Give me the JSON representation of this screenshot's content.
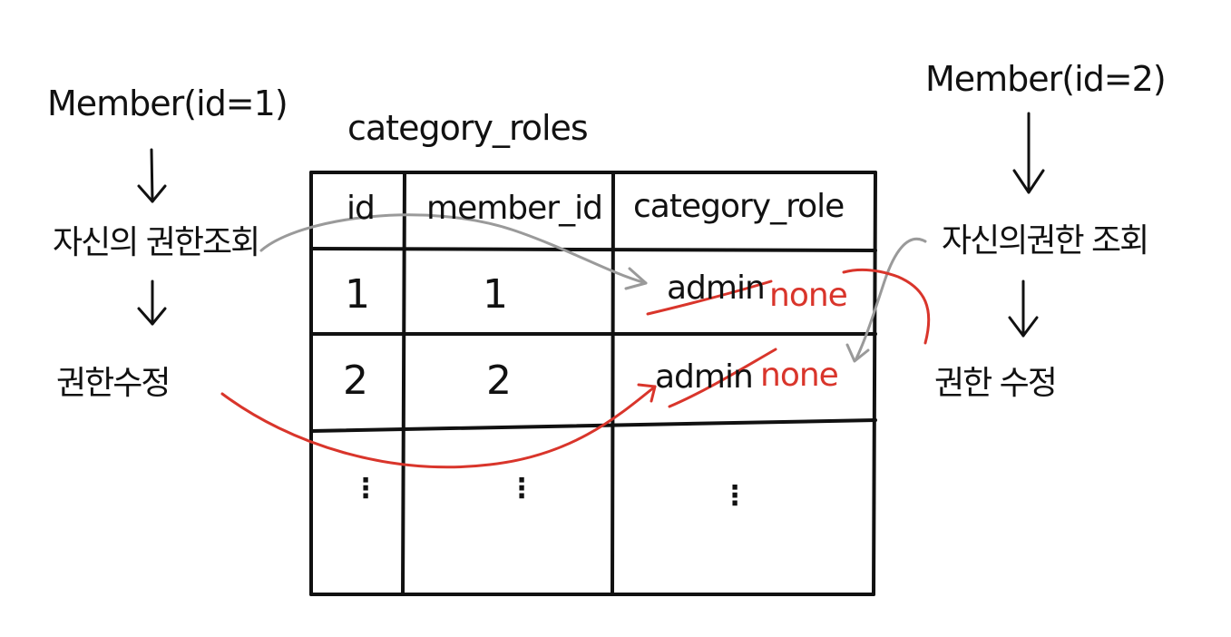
{
  "left_flow": {
    "member": "Member(id=1)",
    "step1": "자신의 권한조회",
    "step2": "권한수정"
  },
  "right_flow": {
    "member": "Member(id=2)",
    "step1": "자신의권한 조회",
    "step2": "권한 수정"
  },
  "table": {
    "name": "category_roles",
    "headers": [
      "id",
      "member_id",
      "category_role"
    ],
    "rows": [
      {
        "id": "1",
        "member_id": "1",
        "old_role": "admin",
        "new_role": "none"
      },
      {
        "id": "2",
        "member_id": "2",
        "old_role": "admin",
        "new_role": "none"
      }
    ],
    "ellipsis": "⋮"
  },
  "colors": {
    "ink": "#111111",
    "read_arrow": "#9a9a9a",
    "update_arrow": "#d9352b"
  }
}
